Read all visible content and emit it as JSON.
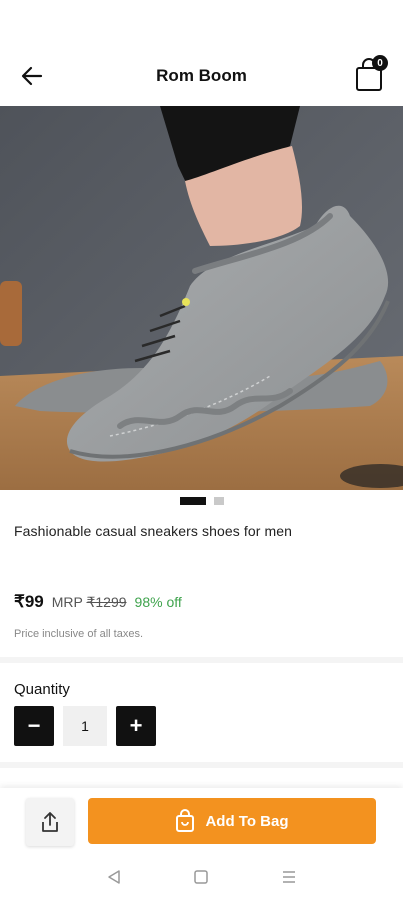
{
  "header": {
    "title": "Rom Boom",
    "back_icon": "arrow-left-icon",
    "bag_icon": "shopping-bag-icon",
    "bag_count": "0"
  },
  "product": {
    "name": "Fashionable casual sneakers shoes for men",
    "image_icon": "product-photo-grey-suede-sneaker",
    "carousel": {
      "total": 2,
      "active_index": 0
    },
    "price": "₹99",
    "mrp_label": "MRP",
    "mrp_value": "₹1299",
    "discount": "98% off",
    "tax_note": "Price inclusive of all taxes."
  },
  "quantity": {
    "label": "Quantity",
    "value": "1",
    "minus_label": "−",
    "plus_label": "+"
  },
  "bottom_bar": {
    "share_icon": "share-icon",
    "add_to_bag_label": "Add To Bag",
    "add_to_bag_icon": "bag-icon"
  },
  "system_nav": {
    "items": [
      "back-triangle-icon",
      "home-square-icon",
      "menu-lines-icon"
    ]
  },
  "colors": {
    "accent": "#f3921f",
    "discount_green": "#3fa34d",
    "button_dark": "#111111"
  }
}
